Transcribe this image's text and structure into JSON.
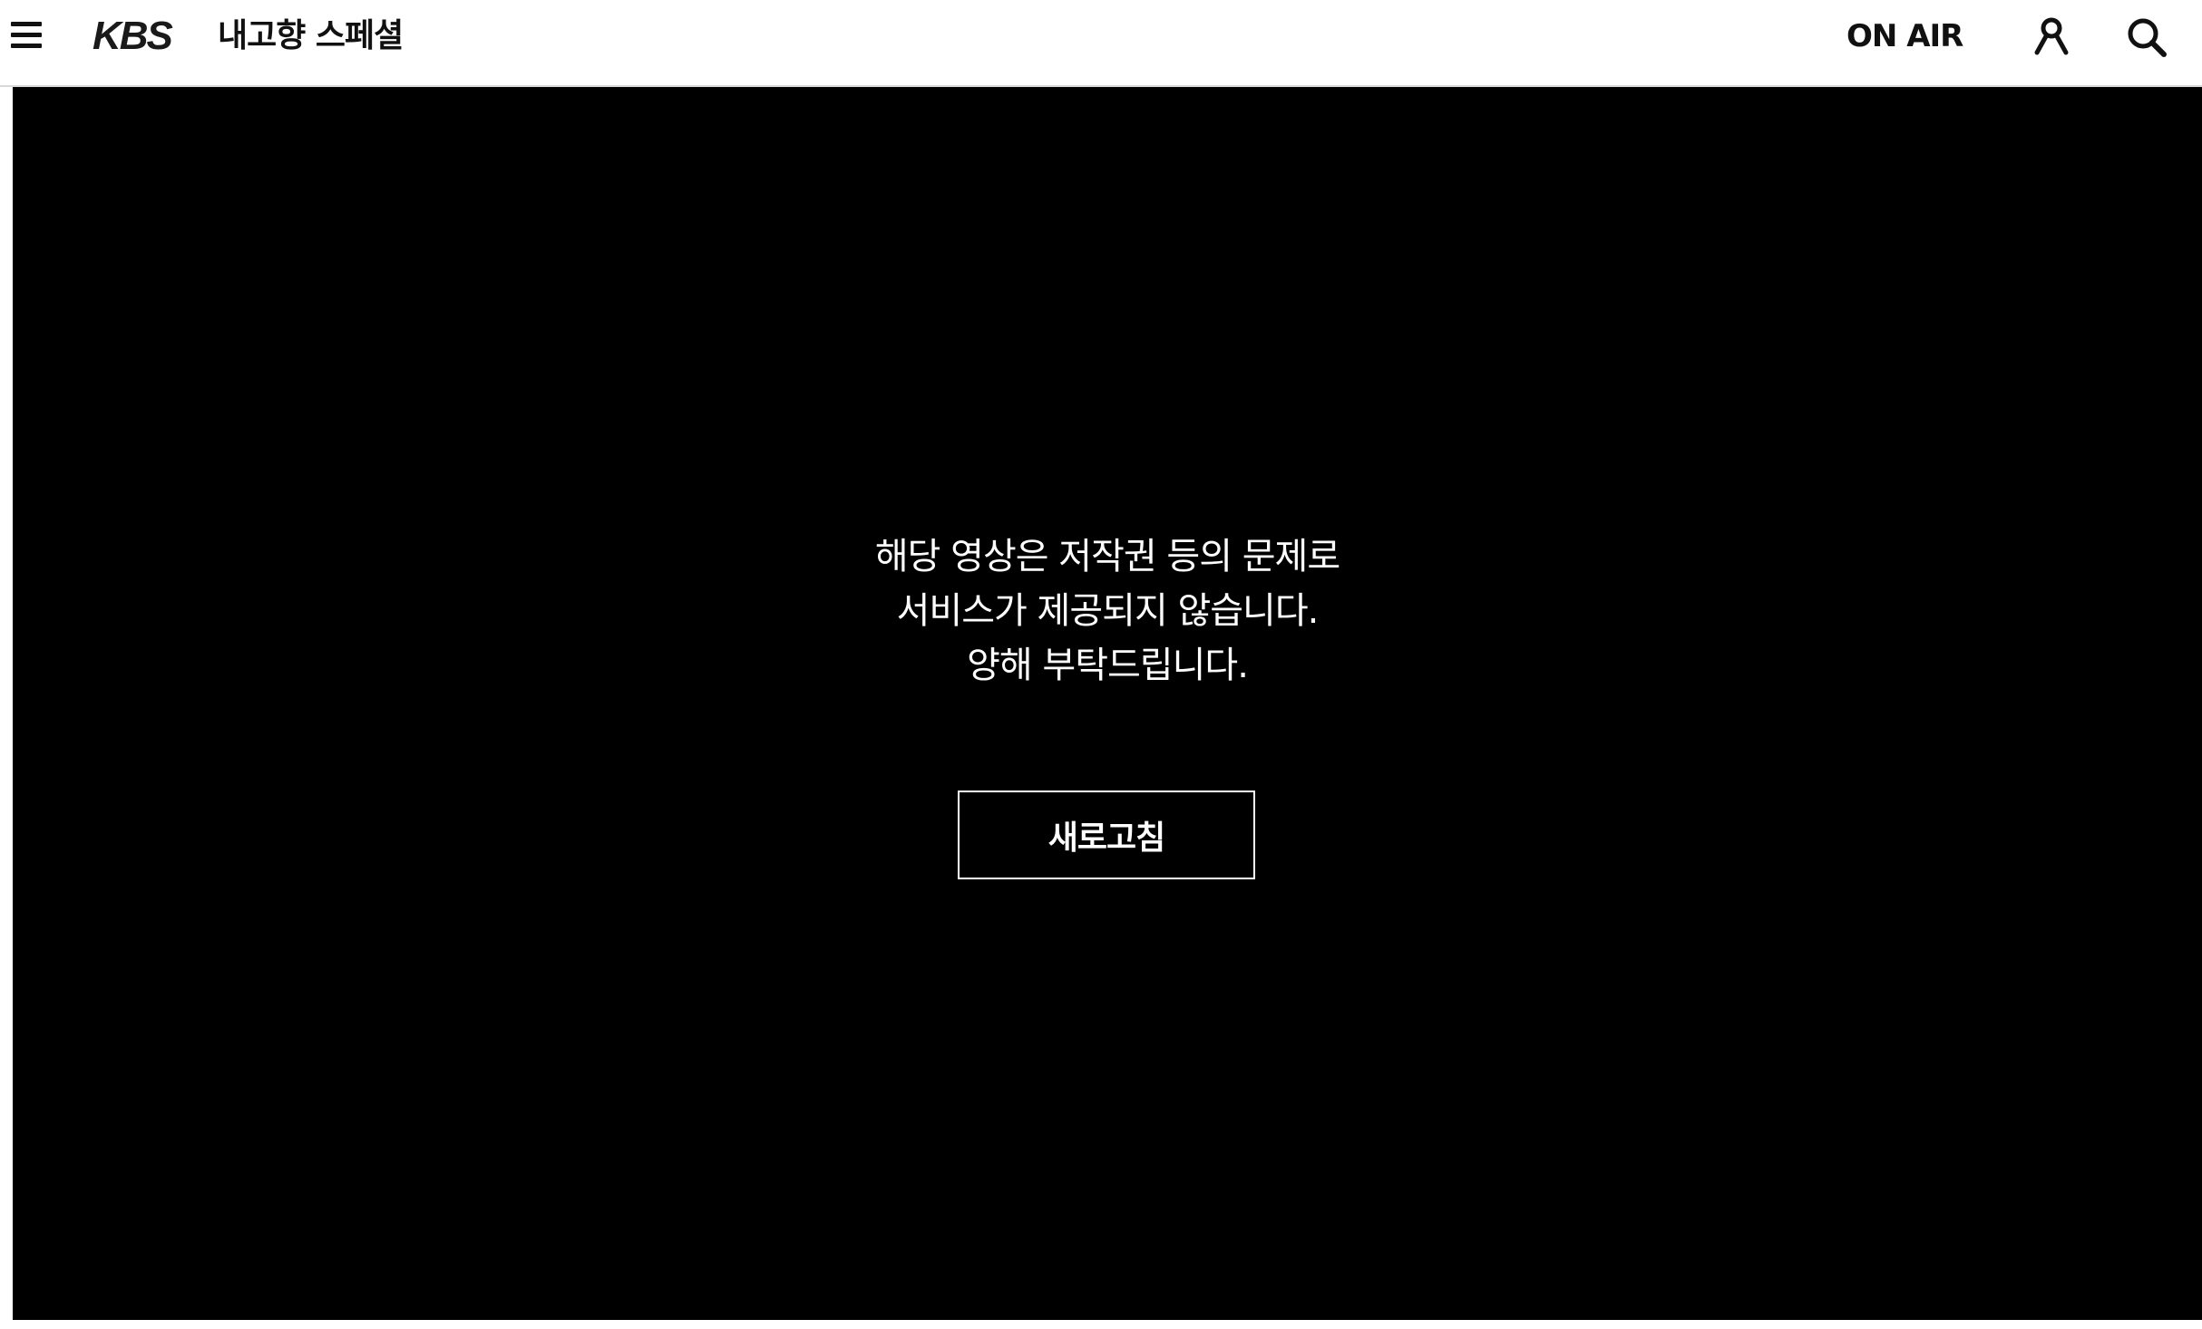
{
  "header": {
    "brand": "KBS",
    "program_title": "내고향 스페셜",
    "onair_label": "ON AIR"
  },
  "player": {
    "notice_lines": [
      "해당 영상은 저작권 등의 문제로",
      "서비스가 제공되지 않습니다.",
      "양해 부탁드립니다."
    ],
    "refresh_label": "새로고침"
  },
  "icons": {
    "menu": "hamburger-menu-icon",
    "user": "user-icon",
    "search": "search-icon"
  },
  "colors": {
    "header_bg": "#ffffff",
    "player_bg": "#000000",
    "text_light": "#ffffff",
    "text_dark": "#111111"
  }
}
